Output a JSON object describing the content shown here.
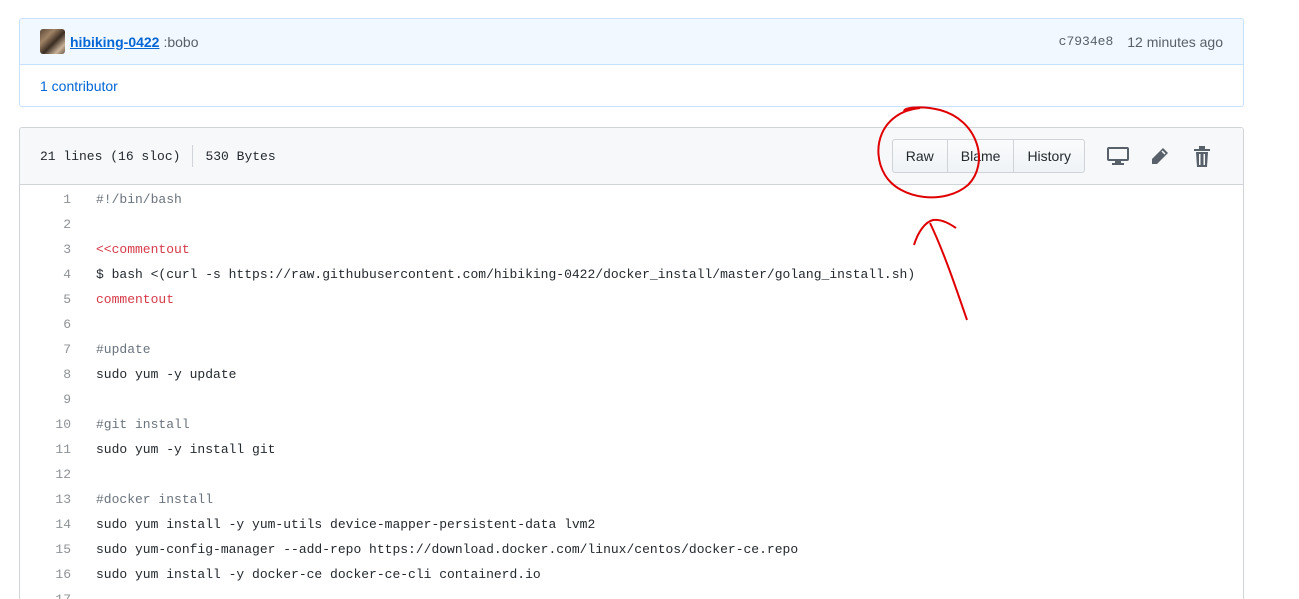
{
  "commit": {
    "author": "hibiking-0422",
    "message": ":bobo",
    "sha": "c7934e8",
    "time": "12 minutes ago",
    "contributors": "1 contributor"
  },
  "file": {
    "lines_info": "21 lines (16 sloc)",
    "size": "530 Bytes",
    "buttons": {
      "raw": "Raw",
      "blame": "Blame",
      "history": "History"
    },
    "icons": [
      "desktop-icon",
      "pencil-icon",
      "trash-icon"
    ]
  },
  "code": [
    {
      "n": "1",
      "text": "#!/bin/bash",
      "kind": "comment"
    },
    {
      "n": "2",
      "text": "",
      "kind": "plain"
    },
    {
      "n": "3",
      "text": "<<commentout",
      "kind": "heredoc"
    },
    {
      "n": "4",
      "text": "$ bash <(curl -s https://raw.githubusercontent.com/hibiking-0422/docker_install/master/golang_install.sh)",
      "kind": "plain"
    },
    {
      "n": "5",
      "text": "commentout",
      "kind": "heredoc"
    },
    {
      "n": "6",
      "text": "",
      "kind": "plain"
    },
    {
      "n": "7",
      "text": "#update",
      "kind": "comment"
    },
    {
      "n": "8",
      "text": "sudo yum -y update",
      "kind": "plain"
    },
    {
      "n": "9",
      "text": "",
      "kind": "plain"
    },
    {
      "n": "10",
      "text": "#git install",
      "kind": "comment"
    },
    {
      "n": "11",
      "text": "sudo yum -y install git",
      "kind": "plain"
    },
    {
      "n": "12",
      "text": "",
      "kind": "plain"
    },
    {
      "n": "13",
      "text": "#docker install",
      "kind": "comment"
    },
    {
      "n": "14",
      "text": "sudo yum install -y yum-utils device-mapper-persistent-data lvm2",
      "kind": "plain"
    },
    {
      "n": "15",
      "text": "sudo yum-config-manager --add-repo https://download.docker.com/linux/centos/docker-ce.repo",
      "kind": "plain"
    },
    {
      "n": "16",
      "text": "sudo yum install -y docker-ce docker-ce-cli containerd.io",
      "kind": "plain"
    },
    {
      "n": "17",
      "text": "",
      "kind": "plain"
    }
  ],
  "colors": {
    "link": "#0366d6",
    "heredoc": "#d73a49",
    "comment": "#6a737d",
    "annotation": "#e00000"
  }
}
